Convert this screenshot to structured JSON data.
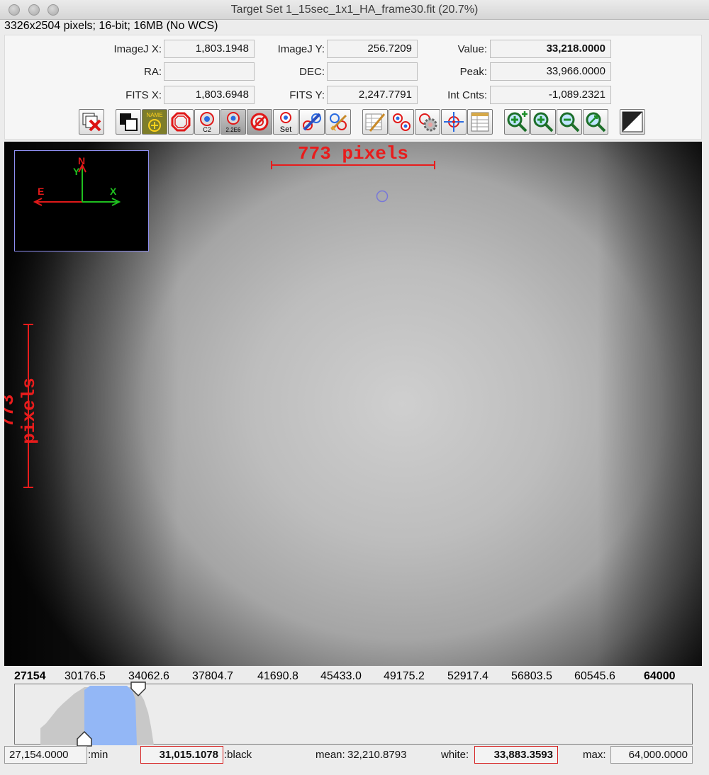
{
  "window": {
    "title": "Target Set 1_15sec_1x1_HA_frame30.fit (20.7%)",
    "info": "3326x2504 pixels; 16-bit; 16MB (No WCS)"
  },
  "coords": {
    "imagej_x_label": "ImageJ X:",
    "imagej_x": "1,803.1948",
    "imagej_y_label": "ImageJ Y:",
    "imagej_y": "256.7209",
    "value_label": "Value:",
    "value": "33,218.0000",
    "ra_label": "RA:",
    "ra": "",
    "dec_label": "DEC:",
    "dec": "",
    "peak_label": "Peak:",
    "peak": "33,966.0000",
    "fits_x_label": "FITS X:",
    "fits_x": "1,803.6948",
    "fits_y_label": "FITS Y:",
    "fits_y": "2,247.7791",
    "intcnts_label": "Int Cnts:",
    "intcnts": "-1,089.2321"
  },
  "toolbar": {
    "name_icon_text": "NAME",
    "c2_text": "C2",
    "e6_text": "2.2E6",
    "set_text": "Set"
  },
  "image": {
    "ruler_h": "773 pixels",
    "ruler_v": "773 pixels",
    "compass": {
      "north": "N",
      "east": "E",
      "x": "X",
      "y": "Y"
    }
  },
  "histogram": {
    "ticks": [
      "27154",
      "30176.5",
      "34062.6",
      "37804.7",
      "41690.8",
      "45433.0",
      "49175.2",
      "52917.4",
      "56803.5",
      "60545.6",
      "64000"
    ],
    "min": "27,154.0000",
    "min_label": ":min",
    "black": "31,015.1078",
    "black_label": ":black",
    "mean_label": "mean:",
    "mean": "32,210.8793",
    "white_label": "white:",
    "white": "33,883.3593",
    "max_label": "max:",
    "max": "64,000.0000"
  },
  "colors": {
    "ruler": "#e81c1c",
    "histo_selected": "#93b7f6",
    "histo_bars": "#c8c8c8"
  }
}
